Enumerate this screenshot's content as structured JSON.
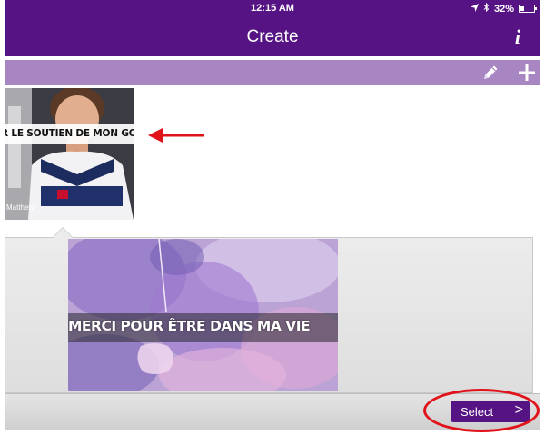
{
  "status_bar": {
    "time": "12:15 AM",
    "battery": "32%",
    "battery_level": 0.32
  },
  "header": {
    "title": "Create",
    "info_icon": "info-icon",
    "info_label": "i"
  },
  "toolbar": {
    "edit_icon": "pencil-icon",
    "add_icon": "plus-icon"
  },
  "thumbnail": {
    "caption": "R LE SOUTIEN DE MON GO",
    "name": "Matthew"
  },
  "preview": {
    "title": "MERCI POUR ÊTRE DANS MA VIE"
  },
  "bottom_bar": {
    "select_label": "Select",
    "select_chevron": ">"
  },
  "colors": {
    "header": "#561384",
    "toolbar": "#a786c2",
    "annotation": "#e1131a"
  }
}
